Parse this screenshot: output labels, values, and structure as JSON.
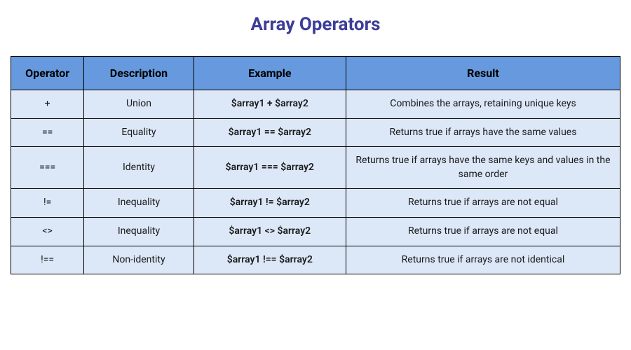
{
  "title": "Array Operators",
  "headers": {
    "operator": "Operator",
    "description": "Description",
    "example": "Example",
    "result": "Result"
  },
  "rows": [
    {
      "operator": "+",
      "description": "Union",
      "example": "$array1 + $array2",
      "result": "Combines the arrays, retaining unique keys"
    },
    {
      "operator": "==",
      "description": "Equality",
      "example": "$array1 == $array2",
      "result": "Returns true if arrays have the same values"
    },
    {
      "operator": "===",
      "description": "Identity",
      "example": "$array1 === $array2",
      "result": "Returns true if arrays have the same keys and values in the same order"
    },
    {
      "operator": "!=",
      "description": "Inequality",
      "example": "$array1 != $array2",
      "result": "Returns true if arrays are not equal"
    },
    {
      "operator": "<>",
      "description": "Inequality",
      "example": "$array1 <> $array2",
      "result": "Returns true if arrays are not equal"
    },
    {
      "operator": "!==",
      "description": "Non-identity",
      "example": "$array1 !== $array2",
      "result": "Returns true if arrays are not identical"
    }
  ]
}
